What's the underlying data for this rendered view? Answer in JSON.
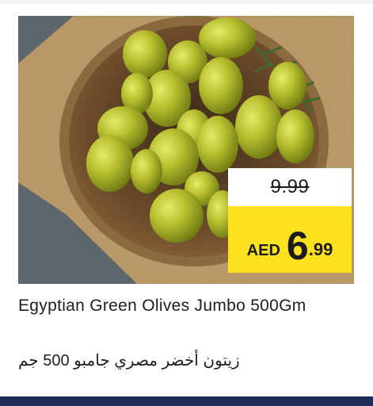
{
  "product": {
    "name_en": "Egyptian Green Olives Jumbo 500Gm",
    "name_ar": "زيتون أخضر مصري جامبو 500 جم",
    "image_icon": "green-olives-in-bowl"
  },
  "price": {
    "old": "9.99",
    "currency": "AED",
    "new_integer": "6",
    "new_decimal": ".99"
  },
  "colors": {
    "price_tag_yellow": "#ffe21f",
    "bottom_bar": "#1f2b57",
    "text": "#1e1e1e"
  }
}
